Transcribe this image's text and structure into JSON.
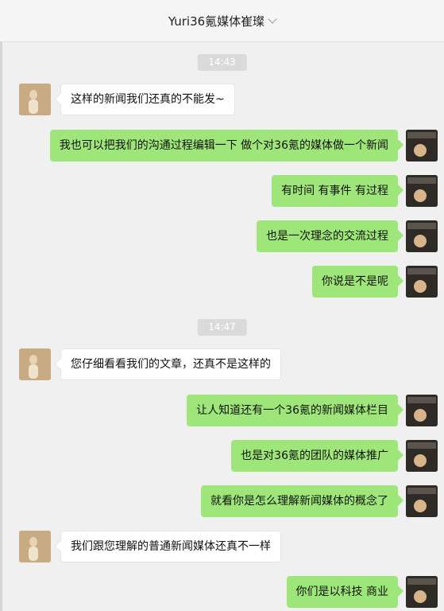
{
  "header": {
    "title": "Yuri36氪媒体崔璨"
  },
  "chat": {
    "timestamps": [
      "14:43",
      "14:47"
    ],
    "messages": [
      {
        "side": "in",
        "text": "这样的新闻我们还真的不能发~"
      },
      {
        "side": "out",
        "text": "我也可以把我们的沟通过程编辑一下  做个对36氪的媒体做一个新闻"
      },
      {
        "side": "out",
        "text": "有时间  有事件  有过程"
      },
      {
        "side": "out",
        "text": "也是一次理念的交流过程"
      },
      {
        "side": "out",
        "text": "你说是不是呢"
      },
      {
        "side": "in",
        "text": "您仔细看看我们的文章，还真不是这样的"
      },
      {
        "side": "out",
        "text": "让人知道还有一个36氪的新闻媒体栏目"
      },
      {
        "side": "out",
        "text": "也是对36氪的团队的媒体推广"
      },
      {
        "side": "out",
        "text": "就看你是怎么理解新闻媒体的概念了"
      },
      {
        "side": "in",
        "text": "我们跟您理解的普通新闻媒体还真不一样"
      },
      {
        "side": "out",
        "text": "你们是以科技  商业"
      }
    ]
  },
  "avatar_colors": {
    "left": "#b89a72",
    "right": "#3a3530"
  }
}
